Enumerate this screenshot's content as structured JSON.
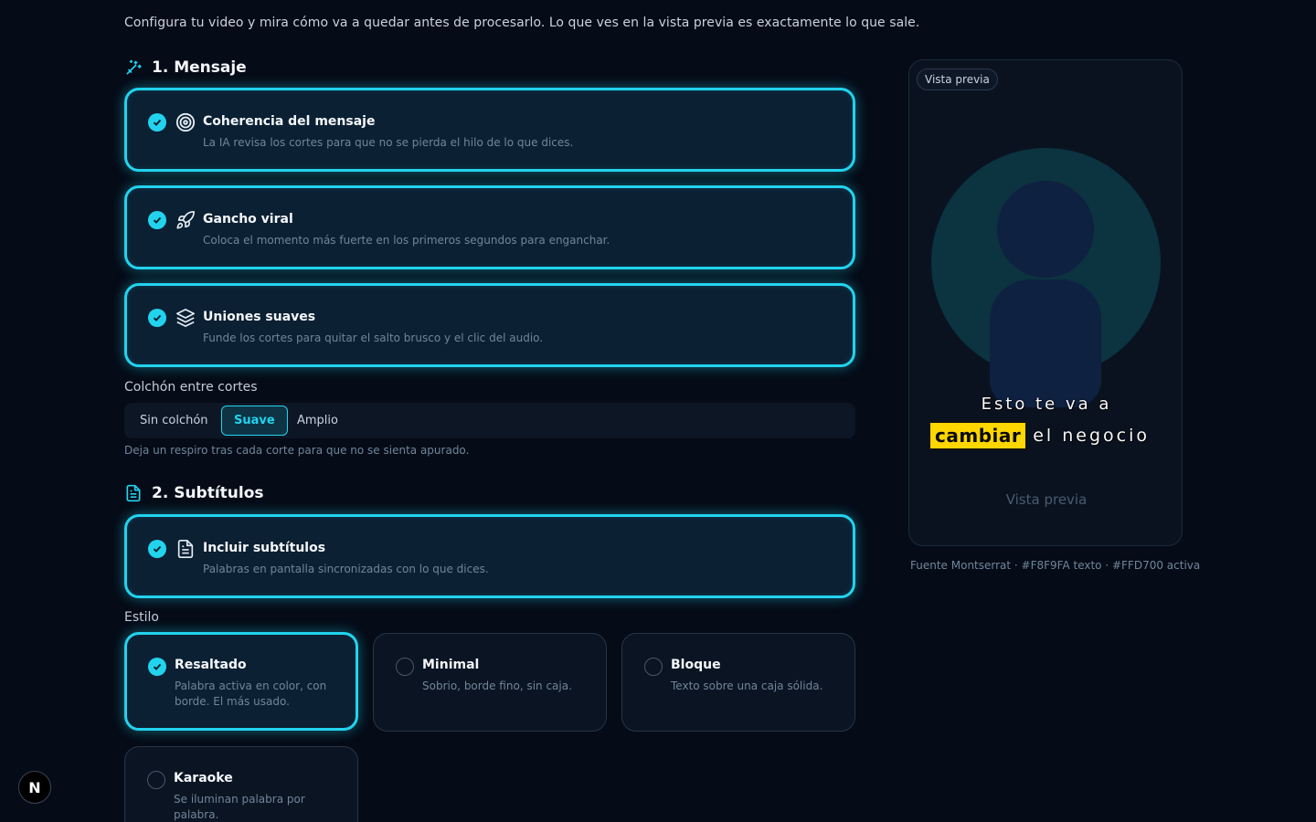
{
  "intro": "Configura tu video y mira cómo va a quedar antes de procesarlo. Lo que ves en la vista previa es exactamente lo que sale.",
  "colors": {
    "accent": "#22d3ee",
    "highlight": "#FFD700",
    "text": "#F8F9FA"
  },
  "sections": {
    "mensaje": {
      "title": "1. Mensaje",
      "icon": "magic-wand-icon",
      "options": [
        {
          "title": "Coherencia del mensaje",
          "desc": "La IA revisa los cortes para que no se pierda el hilo de lo que dices.",
          "icon": "target-icon",
          "checked": true
        },
        {
          "title": "Gancho viral",
          "desc": "Coloca el momento más fuerte en los primeros segundos para enganchar.",
          "icon": "rocket-icon",
          "checked": true
        },
        {
          "title": "Uniones suaves",
          "desc": "Funde los cortes para quitar el salto brusco y el clic del audio.",
          "icon": "layers-icon",
          "checked": true
        }
      ],
      "cushion": {
        "label": "Colchón entre cortes",
        "options": [
          "Sin colchón",
          "Suave",
          "Amplio"
        ],
        "selected": "Suave",
        "hint": "Deja un respiro tras cada corte para que no se sienta apurado."
      }
    },
    "subtitulos": {
      "title": "2. Subtítulos",
      "icon": "document-icon",
      "include": {
        "title": "Incluir subtítulos",
        "desc": "Palabras en pantalla sincronizadas con lo que dices.",
        "icon": "file-text-icon",
        "checked": true
      },
      "style_label": "Estilo",
      "styles": [
        {
          "title": "Resaltado",
          "desc": "Palabra activa en color, con borde. El más usado.",
          "checked": true
        },
        {
          "title": "Minimal",
          "desc": "Sobrio, borde fino, sin caja.",
          "checked": false
        },
        {
          "title": "Bloque",
          "desc": "Texto sobre una caja sólida.",
          "checked": false
        },
        {
          "title": "Karaoke",
          "desc": "Se iluminan palabra por palabra.",
          "checked": false
        }
      ]
    }
  },
  "preview": {
    "badge": "Vista previa",
    "caption_line1": "Esto te va a",
    "caption_active": "cambiar",
    "caption_rest": "el negocio",
    "footer": "Vista previa",
    "font_info": "Fuente Montserrat · #F8F9FA texto · #FFD700 activa"
  },
  "nav_badge": "N"
}
